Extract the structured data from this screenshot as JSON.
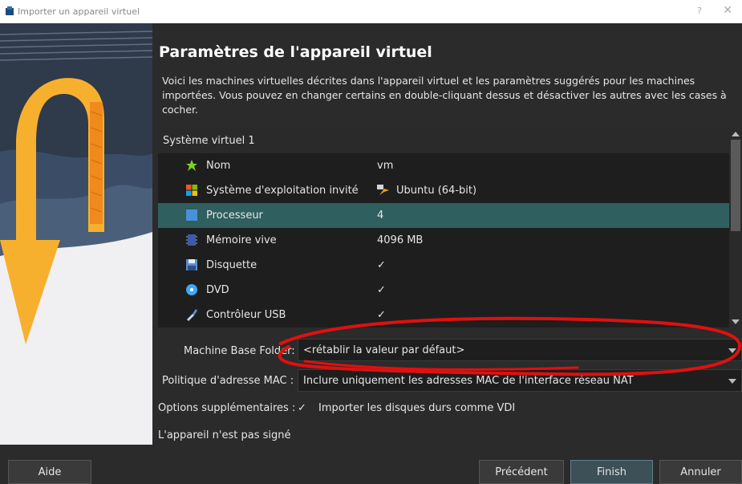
{
  "window": {
    "title": "Importer un appareil virtuel",
    "help_glyph": "?",
    "close_glyph": "✕"
  },
  "page": {
    "heading": "Paramètres de l'appareil virtuel",
    "description": "Voici les machines virtuelles décrites dans l'appareil virtuel et les paramètres suggérés pour les machines importées. Vous pouvez en changer certains en double-cliquant dessus et désactiver les autres avec les cases à cocher."
  },
  "tree": {
    "group_label": "Système virtuel 1",
    "rows": [
      {
        "label": "Nom",
        "value": "vm",
        "icon": "name-icon"
      },
      {
        "label": "Système d'exploitation invité",
        "value": "Ubuntu (64-bit)",
        "icon": "os-icon"
      },
      {
        "label": "Processeur",
        "value": "4",
        "icon": "processor-icon",
        "selected": true
      },
      {
        "label": "Mémoire vive",
        "value": "4096 MB",
        "icon": "memory-icon"
      },
      {
        "label": "Disquette",
        "value": "✓",
        "icon": "floppy-icon"
      },
      {
        "label": "DVD",
        "value": "✓",
        "icon": "dvd-icon"
      },
      {
        "label": "Contrôleur USB",
        "value": "✓",
        "icon": "usb-icon"
      }
    ]
  },
  "form": {
    "base_folder_label": "Machine Base Folder:",
    "base_folder_value": "<rétablir la valeur par défaut>",
    "mac_policy_label": "Politique d'adresse MAC :",
    "mac_policy_value": "Inclure uniquement les adresses MAC de l'interface réseau NAT",
    "extra_options_label": "Options supplémentaires :",
    "import_vdi_check": "✓",
    "import_vdi_label": "Importer les disques durs comme VDI",
    "signature_status": "L'appareil n'est pas signé"
  },
  "buttons": {
    "help": "Aide",
    "previous": "Précédent",
    "finish": "Finish",
    "cancel": "Annuler"
  },
  "colors": {
    "background": "#2b2b2b",
    "tree_background": "#1e1e1e",
    "selection": "#2f5f5f",
    "annotation": "#e01010"
  }
}
